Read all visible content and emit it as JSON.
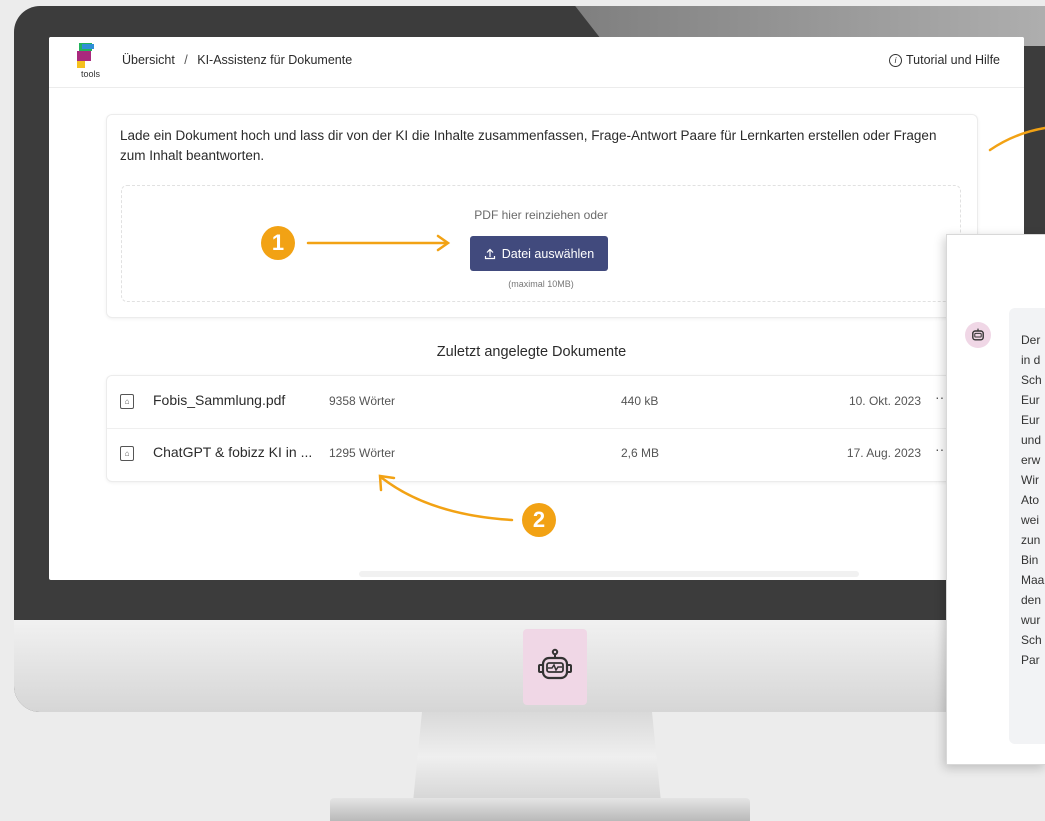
{
  "breadcrumb": {
    "home": "Übersicht",
    "separator": "/",
    "current": "KI-Assistenz für Dokumente"
  },
  "logo": {
    "label": "tools"
  },
  "help": {
    "icon": "info-icon",
    "label": "Tutorial und Hilfe"
  },
  "upload": {
    "intro": "Lade ein Dokument hoch und lass dir von der KI die Inhalte zusammenfassen, Frage-Antwort Paare für Lernkarten erstellen oder Fragen zum Inhalt beantworten.",
    "drop_text": "PDF hier reinziehen oder",
    "button_label": "Datei auswählen",
    "button_icon": "upload-icon",
    "hint": "(maximal 10MB)"
  },
  "recent": {
    "title": "Zuletzt angelegte Dokumente",
    "documents": [
      {
        "name": "Fobis_Sammlung.pdf",
        "words": "9358 Wörter",
        "size": "440 kB",
        "date": "10. Okt. 2023",
        "more": "···"
      },
      {
        "name": "ChatGPT & fobizz KI in ...",
        "words": "1295 Wörter",
        "size": "2,6 MB",
        "date": "17. Aug. 2023",
        "more": "···"
      }
    ]
  },
  "annotations": {
    "badge1": "1",
    "badge2": "2",
    "color": "#f2a214"
  },
  "chat_panel": {
    "avatar_icon": "robot-icon",
    "lines": [
      "Der",
      "in d",
      "Sch",
      "Eur",
      "Eur",
      "und",
      "erw",
      "Wir",
      "Ato",
      "wei",
      "zun",
      "Bin",
      "Maa",
      "den",
      "wur",
      "Sch",
      "Par"
    ]
  },
  "colors": {
    "button": "#414a7d",
    "robot_bg": "#f0d7e6"
  }
}
